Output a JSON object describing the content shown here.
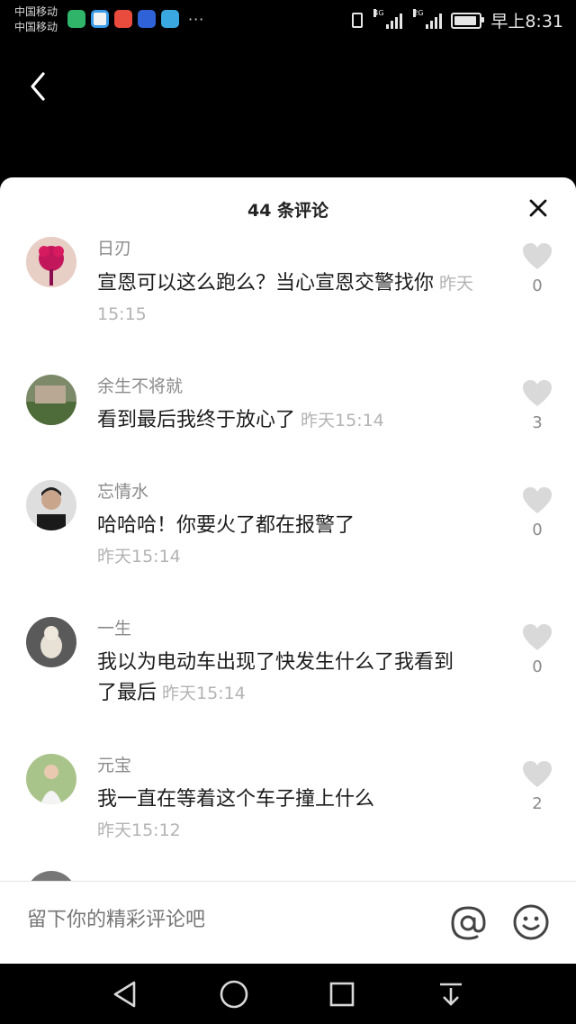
{
  "status_bar": {
    "carrier_1": "中国移动",
    "carrier_2": "中国移动",
    "net_1": "4G",
    "net_2": "2G",
    "more": "···",
    "time": "早上8:31"
  },
  "sheet": {
    "title": "44 条评论"
  },
  "comments": [
    {
      "name": "日刃",
      "text": "宣恩可以这么跑么？当心宣恩交警找你",
      "time": "昨天15:15",
      "likes": "0"
    },
    {
      "name": "余生不将就",
      "text": "看到最后我终于放心了",
      "time": "昨天15:14",
      "likes": "3"
    },
    {
      "name": "忘情水",
      "text": "哈哈哈！你要火了都在报警了",
      "time": "昨天15:14",
      "likes": "0"
    },
    {
      "name": "一生",
      "text": "我以为电动车出现了快发生什么了我看到了最后",
      "time": "昨天15:14",
      "likes": "0"
    },
    {
      "name": "元宝",
      "text": "我一直在等着这个车子撞上什么",
      "time": "昨天15:12",
      "likes": "2"
    }
  ],
  "input": {
    "placeholder": "留下你的精彩评论吧"
  },
  "colors": {
    "sheet_bg": "#ffffff",
    "username": "#8a8a8a",
    "timestamp": "#b3b3b3",
    "heart": "#d9d9d9"
  }
}
